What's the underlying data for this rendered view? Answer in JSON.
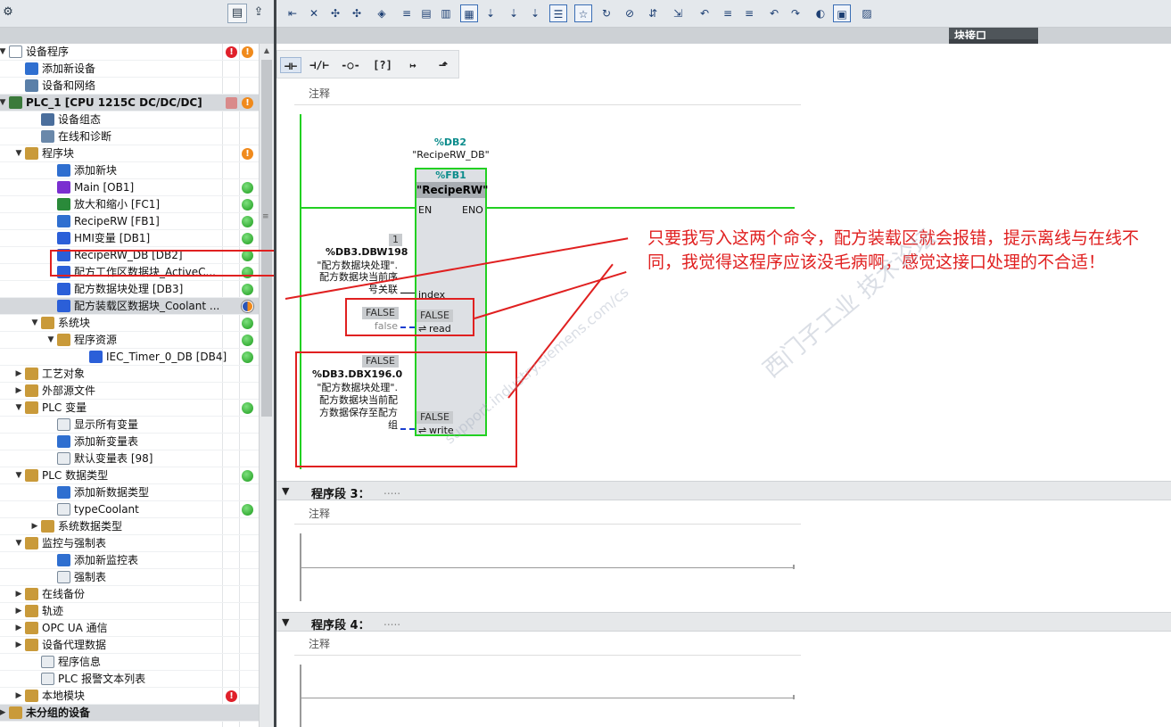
{
  "tree": {
    "items": [
      {
        "label": "设备程序",
        "level": 0,
        "toggle": "expanded",
        "icon": "i-doc",
        "status2": "red-exclaim",
        "status": "orange-exclaim"
      },
      {
        "label": "添加新设备",
        "level": 1,
        "toggle": "",
        "icon": "i-add"
      },
      {
        "label": "设备和网络",
        "level": 1,
        "toggle": "",
        "icon": "i-net"
      },
      {
        "label": "PLC_1 [CPU 1215C DC/DC/DC]",
        "level": 0,
        "toggle": "expanded",
        "icon": "i-plc",
        "bold": true,
        "sel": true,
        "status2": "plug",
        "status": "orange-exclaim"
      },
      {
        "label": "设备组态",
        "level": 2,
        "toggle": "",
        "icon": "i-cfg"
      },
      {
        "label": "在线和诊断",
        "level": 2,
        "toggle": "",
        "icon": "i-diag"
      },
      {
        "label": "程序块",
        "level": 1,
        "toggle": "expanded",
        "icon": "i-fold",
        "status": "orange-exclaim"
      },
      {
        "label": "添加新块",
        "level": 3,
        "toggle": "",
        "icon": "i-add"
      },
      {
        "label": "Main [OB1]",
        "level": 3,
        "toggle": "",
        "icon": "i-ob",
        "status": "green"
      },
      {
        "label": "放大和缩小 [FC1]",
        "level": 3,
        "toggle": "",
        "icon": "i-fc",
        "status": "green"
      },
      {
        "label": "RecipeRW [FB1]",
        "level": 3,
        "toggle": "",
        "icon": "i-fb",
        "status": "green"
      },
      {
        "label": "HMI变量 [DB1]",
        "level": 3,
        "toggle": "",
        "icon": "i-db",
        "status": "green"
      },
      {
        "label": "RecipeRW_DB [DB2]",
        "level": 3,
        "toggle": "",
        "icon": "i-db",
        "status": "green"
      },
      {
        "label": "配方工作区数据块_ActiveC...",
        "level": 3,
        "toggle": "",
        "icon": "i-db",
        "status": "green"
      },
      {
        "label": "配方数据块处理 [DB3]",
        "level": 3,
        "toggle": "",
        "icon": "i-db",
        "status": "green"
      },
      {
        "label": "配方装载区数据块_Coolant ...",
        "level": 3,
        "toggle": "",
        "icon": "i-db",
        "sel": true,
        "status": "half"
      },
      {
        "label": "系统块",
        "level": 2,
        "toggle": "expanded",
        "icon": "i-fold",
        "status": "green"
      },
      {
        "label": "程序资源",
        "level": 3,
        "toggle": "expanded",
        "icon": "i-fold",
        "status": "green"
      },
      {
        "label": "IEC_Timer_0_DB [DB4]",
        "level": 5,
        "toggle": "",
        "icon": "i-db",
        "status": "green"
      },
      {
        "label": "工艺对象",
        "level": 1,
        "toggle": "collapsed",
        "icon": "i-fold"
      },
      {
        "label": "外部源文件",
        "level": 1,
        "toggle": "collapsed",
        "icon": "i-fold"
      },
      {
        "label": "PLC 变量",
        "level": 1,
        "toggle": "expanded",
        "icon": "i-fold",
        "status": "green"
      },
      {
        "label": "显示所有变量",
        "level": 3,
        "toggle": "",
        "icon": "i-tab"
      },
      {
        "label": "添加新变量表",
        "level": 3,
        "toggle": "",
        "icon": "i-add"
      },
      {
        "label": "默认变量表 [98]",
        "level": 3,
        "toggle": "",
        "icon": "i-tab"
      },
      {
        "label": "PLC 数据类型",
        "level": 1,
        "toggle": "expanded",
        "icon": "i-fold",
        "status": "green"
      },
      {
        "label": "添加新数据类型",
        "level": 3,
        "toggle": "",
        "icon": "i-add"
      },
      {
        "label": "typeCoolant",
        "level": 3,
        "toggle": "",
        "icon": "i-tab",
        "status": "green"
      },
      {
        "label": "系统数据类型",
        "level": 2,
        "toggle": "collapsed",
        "icon": "i-fold"
      },
      {
        "label": "监控与强制表",
        "level": 1,
        "toggle": "expanded",
        "icon": "i-fold"
      },
      {
        "label": "添加新监控表",
        "level": 3,
        "toggle": "",
        "icon": "i-add"
      },
      {
        "label": "强制表",
        "level": 3,
        "toggle": "",
        "icon": "i-tab"
      },
      {
        "label": "在线备份",
        "level": 1,
        "toggle": "collapsed",
        "icon": "i-fold"
      },
      {
        "label": "轨迹",
        "level": 1,
        "toggle": "collapsed",
        "icon": "i-fold"
      },
      {
        "label": "OPC UA 通信",
        "level": 1,
        "toggle": "collapsed",
        "icon": "i-fold"
      },
      {
        "label": "设备代理数据",
        "level": 1,
        "toggle": "collapsed",
        "icon": "i-fold"
      },
      {
        "label": "程序信息",
        "level": 2,
        "toggle": "",
        "icon": "i-tab"
      },
      {
        "label": "PLC 报警文本列表",
        "level": 2,
        "toggle": "",
        "icon": "i-tab"
      },
      {
        "label": "本地模块",
        "level": 1,
        "toggle": "collapsed",
        "icon": "i-fold",
        "status2": "red-exclaim"
      },
      {
        "label": "未分组的设备",
        "level": 0,
        "toggle": "collapsed",
        "icon": "i-fold",
        "bold": true,
        "sel": true
      }
    ]
  },
  "editor": {
    "interface_title": "块接口",
    "comment_label": "注释",
    "networks": [
      {
        "title": "程序段 3：",
        "dots": "....."
      },
      {
        "title": "程序段 4：",
        "dots": "....."
      }
    ],
    "block": {
      "instance_db": "%DB2",
      "instance_db_name": "\"RecipeRW_DB\"",
      "fb_number": "%FB1",
      "fb_name": "\"RecipeRW\"",
      "en": "EN",
      "eno": "ENO",
      "pins": {
        "index": "index",
        "read": "read",
        "write": "write"
      },
      "index_value": "1",
      "index_addr": "%DB3.DBW198",
      "index_comment": [
        "\"配方数据块处理\".",
        "配方数据块当前序",
        "号关联"
      ],
      "read_top": "FALSE",
      "read_bottom": "false",
      "read_inner": "FALSE",
      "write_top": "FALSE",
      "write_addr": "%DB3.DBX196.0",
      "write_comment": [
        "\"配方数据块处理\".",
        "配方数据块当前配",
        "方数据保存至配方",
        "组"
      ],
      "write_inner": "FALSE"
    },
    "annotation": "只要我写入这两个命令，配方装载区就会报错，提示离线与在线不同，我觉得这程序应该没毛病啊，感觉这接口处理的不合适！",
    "watermark": "西门子工业 技术论坛",
    "watermark_url": "support.industry.siemens.com/cs"
  },
  "colors": {
    "rung": "#22d022",
    "annotation": "#e02020",
    "teal": "#0c8c8c"
  }
}
